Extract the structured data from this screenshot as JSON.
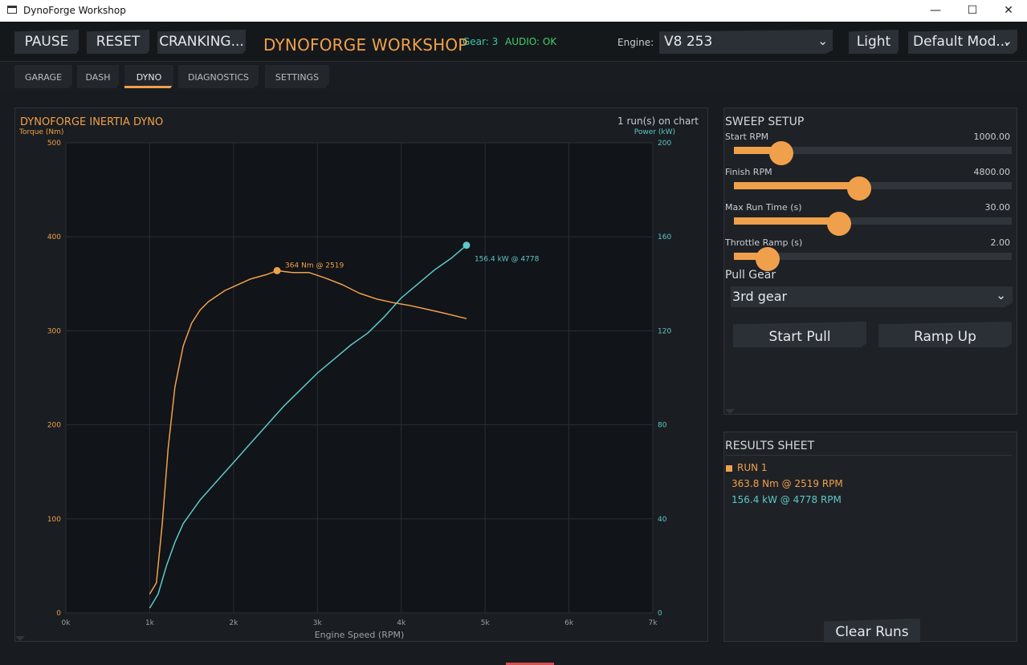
{
  "window": {
    "title": "DynoForge Workshop",
    "controls": {
      "minimize": "—",
      "maximize": "☐",
      "close": "✕"
    }
  },
  "toolbar": {
    "pause": "PAUSE",
    "reset": "RESET",
    "cranking": "CRANKING...",
    "app_title": "DYNOFORGE WORKSHOP",
    "gear_status": "Gear: 3",
    "audio_status": "AUDIO: OK",
    "engine_label": "Engine:",
    "engine_value": "V8 253",
    "theme": "Light",
    "mode_value": "Default Mod...",
    "chevron": "⌄"
  },
  "tabs": [
    {
      "label": "GARAGE",
      "active": false
    },
    {
      "label": "DASH",
      "active": false
    },
    {
      "label": "DYNO",
      "active": true
    },
    {
      "label": "DIAGNOSTICS",
      "active": false
    },
    {
      "label": "SETTINGS",
      "active": false
    }
  ],
  "chart": {
    "title": "DYNOFORGE INERTIA DYNO",
    "runs_label": "1 run(s) on chart"
  },
  "chart_data": {
    "type": "line",
    "title": "DYNOFORGE INERTIA DYNO",
    "xlabel": "Engine Speed (RPM)",
    "ylabel": "Torque (Nm)",
    "y2label": "Power (kW)",
    "xlim": [
      0,
      7000
    ],
    "ylim": [
      0,
      500
    ],
    "y2lim": [
      0,
      200
    ],
    "x_ticks": [
      "0k",
      "1k",
      "2k",
      "3k",
      "4k",
      "5k",
      "6k",
      "7k"
    ],
    "y_ticks": [
      "0",
      "100",
      "200",
      "300",
      "400",
      "500"
    ],
    "y2_ticks": [
      "0",
      "40",
      "80",
      "120",
      "160",
      "200"
    ],
    "grid": true,
    "series": [
      {
        "name": "Torque",
        "axis": "left",
        "color": "#f0a04b",
        "x": [
          1000,
          1080,
          1150,
          1220,
          1300,
          1400,
          1500,
          1600,
          1700,
          1800,
          1900,
          2000,
          2200,
          2400,
          2519,
          2700,
          2900,
          3100,
          3300,
          3500,
          3700,
          3900,
          4100,
          4300,
          4500,
          4778
        ],
        "y": [
          20,
          32,
          95,
          175,
          240,
          284,
          308,
          322,
          331,
          337,
          343,
          347,
          355,
          360,
          364,
          362,
          362,
          356,
          349,
          340,
          334,
          330,
          327,
          323,
          319,
          313
        ]
      },
      {
        "name": "Power",
        "axis": "right",
        "color": "#5ec8c8",
        "x": [
          1000,
          1100,
          1200,
          1300,
          1400,
          1600,
          1800,
          2000,
          2200,
          2400,
          2600,
          2800,
          3000,
          3200,
          3400,
          3600,
          3800,
          4000,
          4200,
          4400,
          4600,
          4778
        ],
        "y": [
          2,
          8,
          20,
          30,
          38,
          48,
          56,
          64,
          72,
          80,
          88,
          95,
          102,
          108,
          114,
          119,
          126,
          134,
          140,
          146,
          151,
          156.4
        ]
      }
    ],
    "annotations": [
      {
        "text": "364 Nm @ 2519",
        "series": "Torque",
        "x": 2519,
        "y": 364
      },
      {
        "text": "156.4 kW @ 4778",
        "series": "Power",
        "x": 4778,
        "y": 156.4
      }
    ]
  },
  "sweep": {
    "title": "SWEEP SETUP",
    "sliders": [
      {
        "label": "Start RPM",
        "value": "1000.00",
        "fraction": 0.17
      },
      {
        "label": "Finish RPM",
        "value": "4800.00",
        "fraction": 0.45
      },
      {
        "label": "Max Run Time (s)",
        "value": "30.00",
        "fraction": 0.38
      },
      {
        "label": "Throttle Ramp (s)",
        "value": "2.00",
        "fraction": 0.12
      }
    ],
    "pull_gear_label": "Pull Gear",
    "pull_gear_value": "3rd gear",
    "start_pull": "Start Pull",
    "ramp_up": "Ramp Up"
  },
  "results": {
    "title": "RESULTS SHEET",
    "run_name": "RUN 1",
    "run_color": "#f0a04b",
    "torque_line": "363.8 Nm @ 2519 RPM",
    "power_line": "156.4 kW @ 4778 RPM",
    "clear_runs": "Clear Runs"
  }
}
